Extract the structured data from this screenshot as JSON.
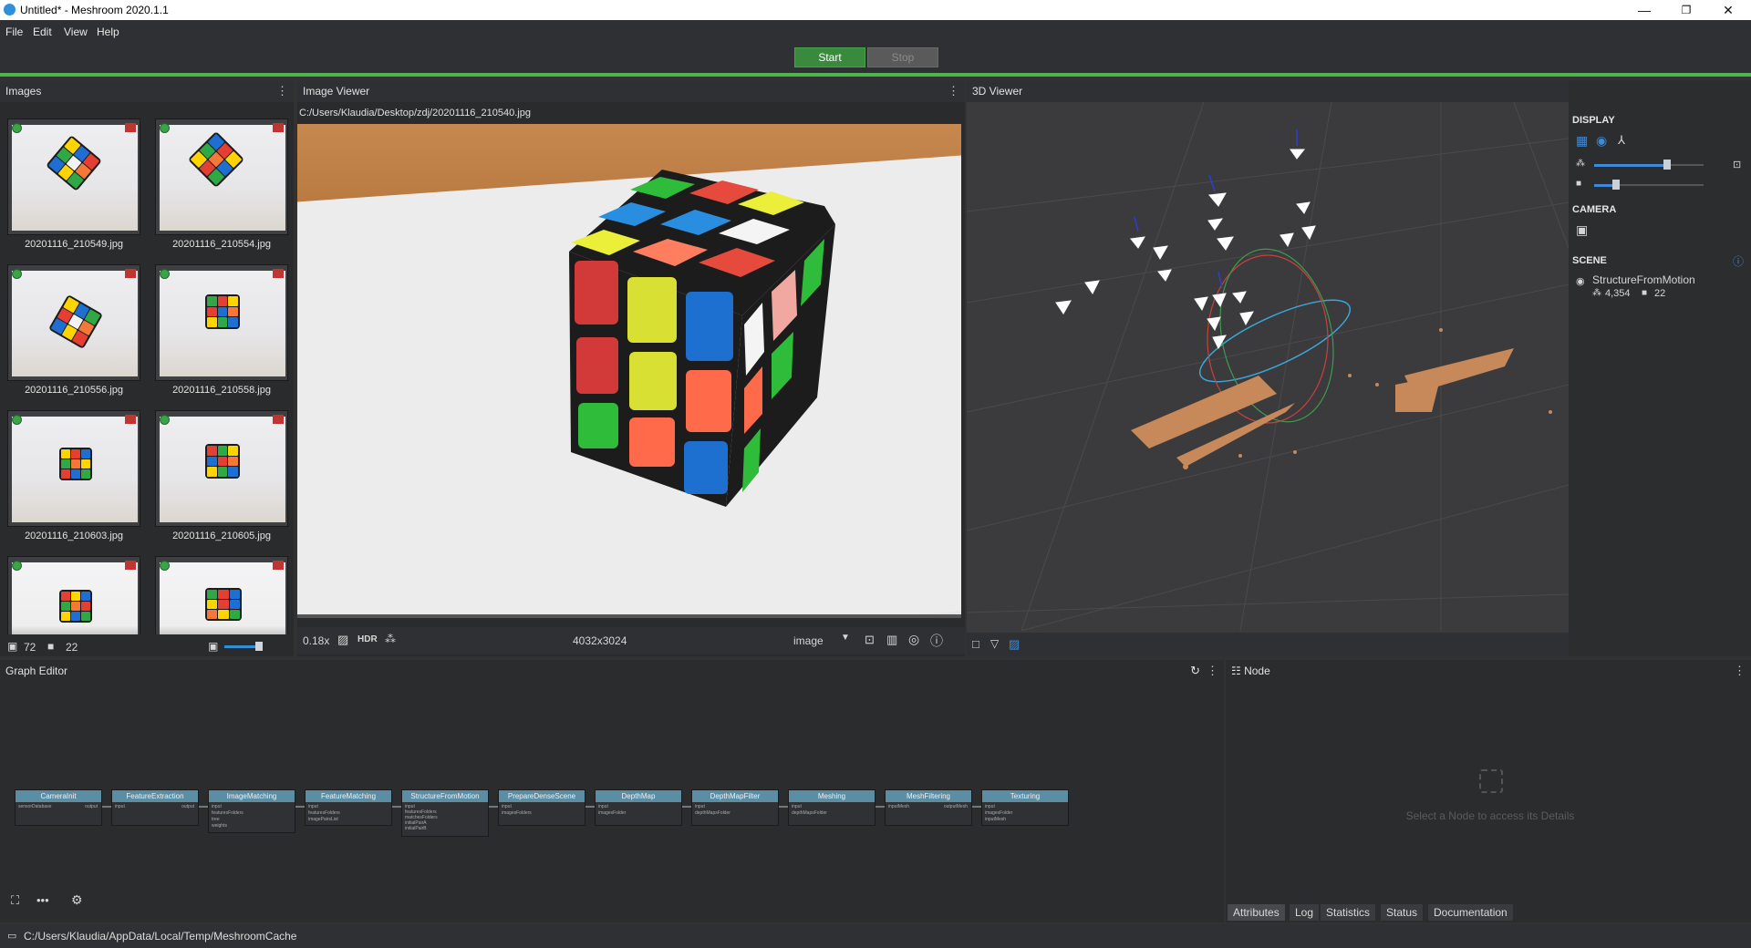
{
  "window": {
    "title": "Untitled* - Meshroom 2020.1.1",
    "min": "—",
    "max": "❐",
    "close": "✕"
  },
  "menu": [
    "File",
    "Edit",
    "View",
    "Help"
  ],
  "runbar": {
    "start": "Start",
    "stop": "Stop",
    "progress": 1.0
  },
  "images": {
    "header": "Images",
    "thumbs": [
      {
        "name": "20201116_210549.jpg"
      },
      {
        "name": "20201116_210554.jpg"
      },
      {
        "name": "20201116_210556.jpg"
      },
      {
        "name": "20201116_210558.jpg"
      },
      {
        "name": "20201116_210603.jpg"
      },
      {
        "name": "20201116_210605.jpg"
      },
      {
        "name": ""
      },
      {
        "name": ""
      }
    ],
    "image_count": "72",
    "camera_count": "22"
  },
  "viewer": {
    "header": "Image Viewer",
    "path": "C:/Users/Klaudia/Desktop/zdj/20201116_210540.jpg",
    "zoom": "0.18x",
    "hdr": "HDR",
    "resolution": "4032x3024",
    "mode": "image"
  },
  "three": {
    "header": "3D Viewer",
    "display": "DISPLAY",
    "camera": "CAMERA",
    "scene": "SCENE",
    "scene_item": "StructureFromMotion",
    "points": "4,354",
    "cams": "22"
  },
  "graph": {
    "header": "Graph Editor",
    "nodes": [
      {
        "title": "CameraInit",
        "ports": [
          "sensorDatabase",
          "output"
        ]
      },
      {
        "title": "FeatureExtraction",
        "ports": [
          "input",
          "output"
        ]
      },
      {
        "title": "ImageMatching",
        "ports": [
          "input",
          "featuresFolders",
          "tree",
          "weights"
        ]
      },
      {
        "title": "FeatureMatching",
        "ports": [
          "input",
          "featuresFolders",
          "imagePairsList"
        ]
      },
      {
        "title": "StructureFromMotion",
        "ports": [
          "input",
          "featuresFolders",
          "matchesFolders",
          "initialPairA",
          "initialPairB"
        ]
      },
      {
        "title": "PrepareDenseScene",
        "ports": [
          "input",
          "imagesFolders"
        ]
      },
      {
        "title": "DepthMap",
        "ports": [
          "input",
          "imagesFolder"
        ]
      },
      {
        "title": "DepthMapFilter",
        "ports": [
          "input",
          "depthMapsFolder"
        ]
      },
      {
        "title": "Meshing",
        "ports": [
          "input",
          "depthMapsFolder"
        ]
      },
      {
        "title": "MeshFiltering",
        "ports": [
          "inputMesh",
          "outputMesh"
        ]
      },
      {
        "title": "Texturing",
        "ports": [
          "input",
          "imagesFolder",
          "inputMesh"
        ]
      }
    ]
  },
  "node": {
    "header": "Node",
    "placeholder": "Select a Node to access its Details",
    "tabs": [
      "Attributes",
      "Log",
      "Statistics",
      "Status",
      "Documentation"
    ]
  },
  "status": {
    "cache": "C:/Users/Klaudia/AppData/Local/Temp/MeshroomCache"
  }
}
